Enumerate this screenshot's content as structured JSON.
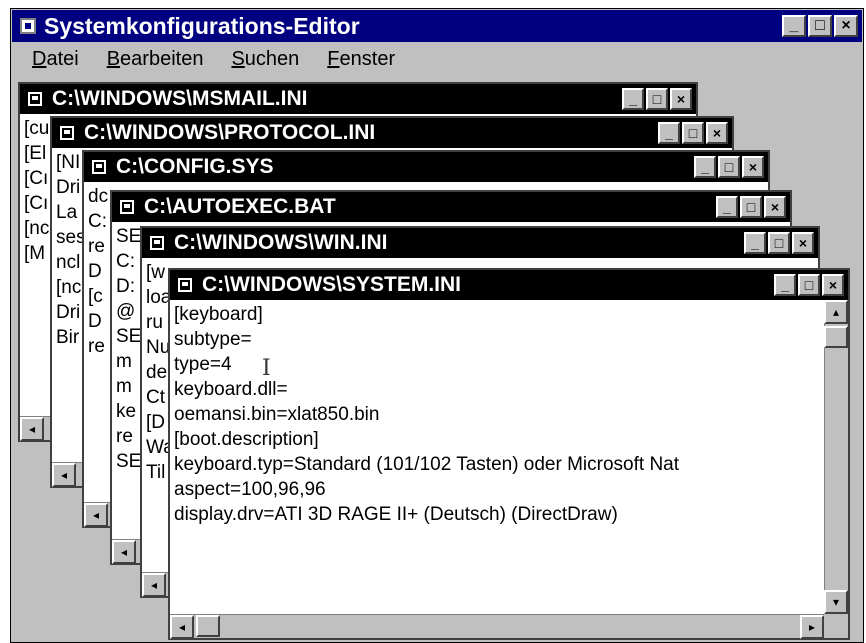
{
  "app": {
    "title": "Systemkonfigurations-Editor",
    "menu": [
      "Datei",
      "Bearbeiten",
      "Suchen",
      "Fenster"
    ]
  },
  "controls": {
    "minimize": "_",
    "maximize": "□",
    "close": "×"
  },
  "windows": [
    {
      "title": "C:\\WINDOWS\\MSMAIL.INI",
      "lines": [
        "[cu",
        "",
        "[El",
        "",
        "[Cı",
        "",
        "[Cı",
        "",
        "[nc",
        "[M"
      ]
    },
    {
      "title": "C:\\WINDOWS\\PROTOCOL.INI",
      "lines": [
        "[NI",
        "Dri",
        "La",
        "ses",
        "ncl",
        "",
        "[nc",
        "Dri",
        "Bir"
      ]
    },
    {
      "title": "C:\\CONFIG.SYS",
      "lines": [
        "dc",
        "C:",
        "re",
        "D",
        "",
        "[c",
        "D",
        "re"
      ]
    },
    {
      "title": "C:\\AUTOEXEC.BAT",
      "lines": [
        "SE",
        "C:",
        "D:",
        "@",
        "SE",
        "m",
        "m",
        "ke",
        "re",
        "SE"
      ]
    },
    {
      "title": "C:\\WINDOWS\\WIN.INI",
      "lines": [
        "[w",
        "loa",
        "ru",
        "Nu",
        "de",
        "Ct",
        "",
        "[D",
        "Wa",
        "Til"
      ]
    },
    {
      "title": "C:\\WINDOWS\\SYSTEM.INI",
      "lines": [
        "[keyboard]",
        "subtype=",
        "type=4",
        "keyboard.dll=",
        "oemansi.bin=xlat850.bin",
        "",
        "[boot.description]",
        "keyboard.typ=Standard (101/102 Tasten) oder Microsoft Nat",
        "aspect=100,96,96",
        "display.drv=ATI 3D RAGE II+ (Deutsch) (DirectDraw)"
      ]
    }
  ]
}
